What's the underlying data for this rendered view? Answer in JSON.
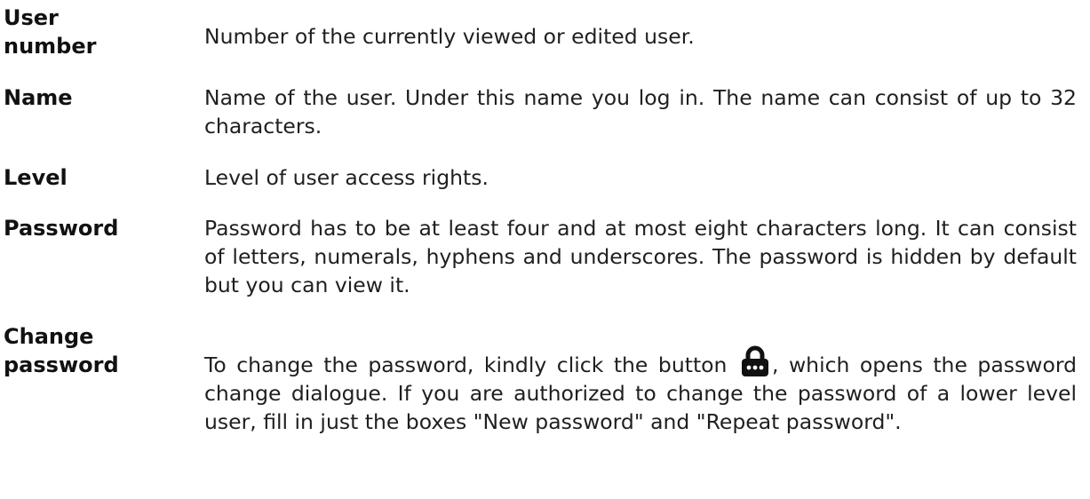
{
  "entries": [
    {
      "term_line1": "User",
      "term_line2": "number",
      "description": "Number of the currently viewed or edited user."
    },
    {
      "term": "Name",
      "description": "Name of the user. Under this name you log in. The name can consist of up to 32 characters."
    },
    {
      "term": "Level",
      "description": "Level of user access rights."
    },
    {
      "term": "Password",
      "description": "Password has to be at least four and at most eight characters long. It can consist of letters, numerals, hyphens and underscores. The password is hidden by default but you can view it."
    },
    {
      "term_line1": "Change",
      "term_line2": "password",
      "description_before_icon": "To change the password, kindly click the button",
      "description_after_icon": ", which opens the password change dialogue. If you are authorized to change the password of a lower level user, fill in just the boxes \"New password\" and \"Repeat password\".",
      "icon": "lock-icon"
    }
  ],
  "colors": {
    "text": "#1f1f1f",
    "term": "#111111",
    "icon": "#111111"
  }
}
